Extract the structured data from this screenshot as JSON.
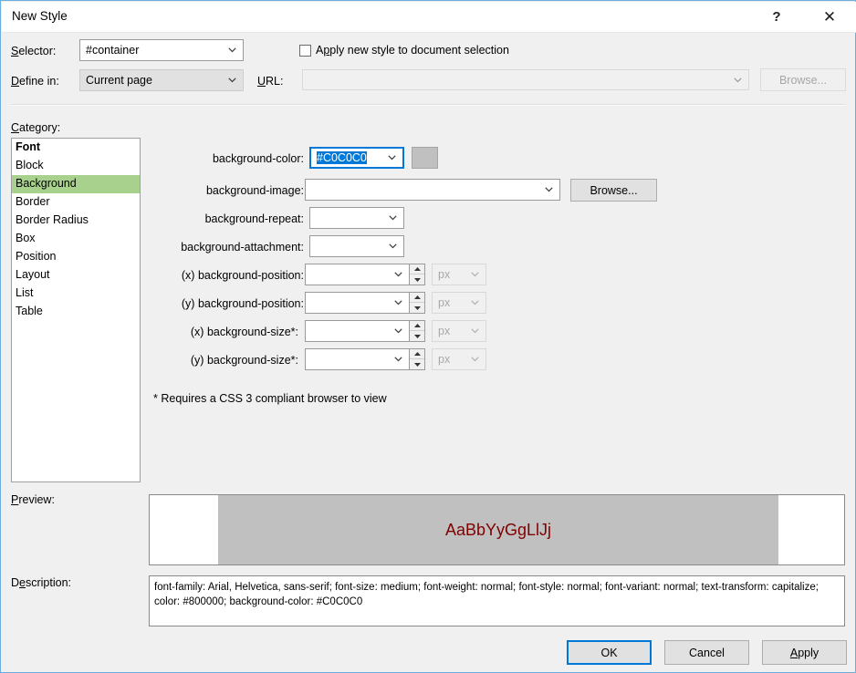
{
  "window": {
    "title": "New Style",
    "help_label": "?",
    "close_label": "✕",
    "accent_color": "#0078d7",
    "border_color": "#6cade0",
    "dialog_bg": "#f0f0f0"
  },
  "top": {
    "selector_label": "Selector:",
    "selector_label_accel": "S",
    "selector_value": "#container",
    "define_in_label": "Define in:",
    "define_in_label_accel": "D",
    "define_in_value": "Current page",
    "url_label": "URL:",
    "url_label_accel": "U",
    "url_value": "",
    "url_enabled": false,
    "browse_label": "Browse...",
    "browse_enabled": false,
    "apply_checkbox_label": "Apply new style to document selection",
    "apply_checkbox_accel": "p",
    "apply_checkbox_checked": false
  },
  "category": {
    "label": "Category:",
    "label_accel": "C",
    "items": [
      {
        "label": "Font",
        "bold": true,
        "selected": false
      },
      {
        "label": "Block",
        "bold": false,
        "selected": false
      },
      {
        "label": "Background",
        "bold": false,
        "selected": true
      },
      {
        "label": "Border",
        "bold": false,
        "selected": false
      },
      {
        "label": "Border Radius",
        "bold": false,
        "selected": false
      },
      {
        "label": "Box",
        "bold": false,
        "selected": false
      },
      {
        "label": "Position",
        "bold": false,
        "selected": false
      },
      {
        "label": "Layout",
        "bold": false,
        "selected": false
      },
      {
        "label": "List",
        "bold": false,
        "selected": false
      },
      {
        "label": "Table",
        "bold": false,
        "selected": false
      }
    ],
    "selected_color": "#a9d18e"
  },
  "fields": {
    "background_color": {
      "label": "background-color:",
      "value": "#C0C0C0",
      "focused": true,
      "text_selected": true,
      "swatch_color": "#C0C0C0"
    },
    "background_image": {
      "label": "background-image:",
      "value": "",
      "browse_label": "Browse..."
    },
    "background_repeat": {
      "label": "background-repeat:",
      "value": ""
    },
    "background_attachment": {
      "label": "background-attachment:",
      "value": ""
    },
    "background_position_x": {
      "label": "(x) background-position:",
      "value": "",
      "unit": "px",
      "unit_enabled": false
    },
    "background_position_y": {
      "label": "(y) background-position:",
      "value": "",
      "unit": "px",
      "unit_enabled": false
    },
    "background_size_x": {
      "label": "(x) background-size*:",
      "value": "",
      "unit": "px",
      "unit_enabled": false
    },
    "background_size_y": {
      "label": "(y) background-size*:",
      "value": "",
      "unit": "px",
      "unit_enabled": false
    }
  },
  "footnote": "* Requires a CSS 3 compliant browser to view",
  "preview": {
    "label": "Preview:",
    "label_accel": "P",
    "sample_text": "AaBbYyGgLlJj",
    "text_color": "#800000",
    "swatch_color": "#C0C0C0"
  },
  "description": {
    "label": "Description:",
    "label_accel": "e",
    "text": "font-family: Arial, Helvetica, sans-serif; font-size: medium; font-weight: normal; font-style: normal; font-variant: normal; text-transform: capitalize; color: #800000; background-color: #C0C0C0"
  },
  "buttons": {
    "ok": "OK",
    "cancel": "Cancel",
    "apply": "Apply",
    "apply_accel": "A",
    "default_button": "ok"
  }
}
